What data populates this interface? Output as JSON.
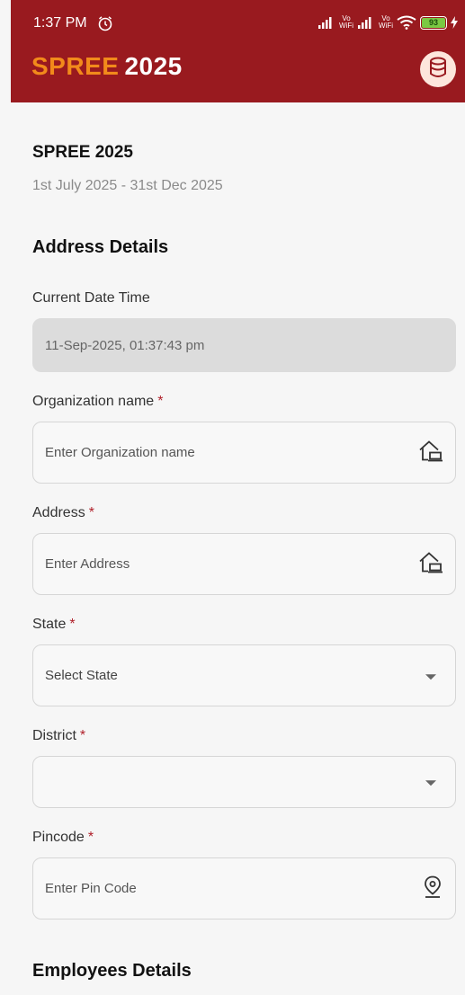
{
  "status_bar": {
    "time": "1:37 PM",
    "battery": "93"
  },
  "header": {
    "logo_part1": "SPREE",
    "logo_part2": "2025"
  },
  "event": {
    "title": "SPREE 2025",
    "dates": "1st July 2025 - 31st Dec 2025"
  },
  "address_section": {
    "title": "Address Details",
    "current_date_label": "Current Date Time",
    "current_date_value": "11-Sep-2025, 01:37:43 pm",
    "org_label": "Organization name",
    "org_placeholder": "Enter Organization name",
    "address_label": "Address",
    "address_placeholder": "Enter Address",
    "state_label": "State",
    "state_value": "Select State",
    "district_label": "District",
    "district_value": "",
    "pincode_label": "Pincode",
    "pincode_placeholder": "Enter Pin Code",
    "required_mark": "*"
  },
  "employees_section": {
    "title": "Employees Details"
  },
  "colors": {
    "header_bg": "#991a1f",
    "logo_orange": "#f28a1b",
    "required_red": "#b0202a"
  },
  "icons": {
    "database": "database-icon",
    "home": "home-icon",
    "location": "location-pin-icon",
    "dropdown": "dropdown-arrow-icon"
  }
}
